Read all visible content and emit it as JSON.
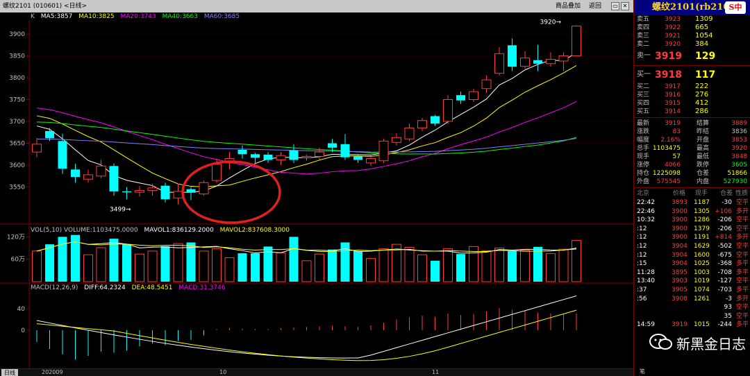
{
  "window": {
    "title": "螺纹2101 (010601) <日线>",
    "menu_add": "商品叠加",
    "menu_back": "返回",
    "btns": [
      "□",
      "▭",
      "✕"
    ]
  },
  "kline_legend": {
    "k": "K",
    "ma5": "MA5:3857",
    "ma10": "MA10:3825",
    "ma20": "MA20:3743",
    "ma40": "MA40:3663",
    "ma60": "MA60:3685"
  },
  "vol_legend": {
    "vol": "VOL(5,10) VOLUME:1103475.0000",
    "mavol1": "MAVOL1:836129.2000",
    "mavol2": "MAVOL2:837608.3000"
  },
  "macd_legend": {
    "macd": "MACD(12,26,9)",
    "diff": "DIFF:64.2324",
    "dea": "DEA:48.5451",
    "macdval": "MACD:31.3746"
  },
  "price_axis": [
    "3900",
    "3850",
    "3800",
    "3750",
    "3700",
    "3650",
    "3600",
    "3550"
  ],
  "vol_axis": [
    "120万",
    "60万"
  ],
  "macd_axis": [
    "40",
    "0"
  ],
  "annotations": {
    "high": "3920→",
    "low": "3499→"
  },
  "x_labels": {
    "tab": "日线",
    "start": "202009",
    "m10": "10",
    "m11": "11"
  },
  "colors": {
    "up": "#ff3b3b",
    "down": "#00ffff",
    "ma5": "#ffffff",
    "ma10": "#ffff00",
    "ma20": "#ff00ff",
    "ma40": "#00ff00",
    "ma60": "#8080ff",
    "circle": "#e02020"
  },
  "chart_data": {
    "type": "candlestick",
    "title": "螺纹2101 (010601) 日线",
    "ylim": [
      3470,
      3930
    ],
    "candles": [
      {
        "o": 3630,
        "c": 3648,
        "h": 3662,
        "l": 3618,
        "v": 820000,
        "m": -22
      },
      {
        "o": 3678,
        "c": 3662,
        "h": 3685,
        "l": 3655,
        "v": 1000000,
        "m": -35
      },
      {
        "o": 3655,
        "c": 3592,
        "h": 3672,
        "l": 3580,
        "v": 1200000,
        "m": -45
      },
      {
        "o": 3590,
        "c": 3573,
        "h": 3603,
        "l": 3560,
        "v": 1250000,
        "m": -55
      },
      {
        "o": 3568,
        "c": 3578,
        "h": 3590,
        "l": 3560,
        "v": 720000,
        "m": -48
      },
      {
        "o": 3575,
        "c": 3598,
        "h": 3612,
        "l": 3570,
        "v": 910000,
        "m": -40
      },
      {
        "o": 3598,
        "c": 3540,
        "h": 3604,
        "l": 3530,
        "v": 1150000,
        "m": -42
      },
      {
        "o": 3540,
        "c": 3538,
        "h": 3550,
        "l": 3522,
        "v": 1000000,
        "m": -38
      },
      {
        "o": 3538,
        "c": 3542,
        "h": 3552,
        "l": 3528,
        "v": 740000,
        "m": -30
      },
      {
        "o": 3542,
        "c": 3548,
        "h": 3558,
        "l": 3530,
        "v": 820000,
        "m": -25
      },
      {
        "o": 3553,
        "c": 3522,
        "h": 3560,
        "l": 3515,
        "v": 950000,
        "m": -28
      },
      {
        "o": 3525,
        "c": 3540,
        "h": 3558,
        "l": 3510,
        "v": 1020000,
        "m": -20
      },
      {
        "o": 3545,
        "c": 3537,
        "h": 3550,
        "l": 3520,
        "v": 1050000,
        "m": -18
      },
      {
        "o": 3534,
        "c": 3560,
        "h": 3565,
        "l": 3530,
        "v": 820000,
        "m": -10
      },
      {
        "o": 3565,
        "c": 3602,
        "h": 3615,
        "l": 3560,
        "v": 880000,
        "m": 2
      },
      {
        "o": 3605,
        "c": 3615,
        "h": 3630,
        "l": 3590,
        "v": 640000,
        "m": 4
      },
      {
        "o": 3635,
        "c": 3625,
        "h": 3645,
        "l": 3615,
        "v": 760000,
        "m": 3
      },
      {
        "o": 3625,
        "c": 3617,
        "h": 3628,
        "l": 3605,
        "v": 760000,
        "m": 2
      },
      {
        "o": 3624,
        "c": 3612,
        "h": 3630,
        "l": 3605,
        "v": 940000,
        "m": 2
      },
      {
        "o": 3612,
        "c": 3622,
        "h": 3630,
        "l": 3600,
        "v": 770000,
        "m": 4
      },
      {
        "o": 3634,
        "c": 3612,
        "h": 3648,
        "l": 3605,
        "v": 1200000,
        "m": 5
      },
      {
        "o": 3617,
        "c": 3620,
        "h": 3624,
        "l": 3610,
        "v": 560000,
        "m": 6
      },
      {
        "o": 3620,
        "c": 3630,
        "h": 3640,
        "l": 3612,
        "v": 740000,
        "m": 7
      },
      {
        "o": 3650,
        "c": 3640,
        "h": 3660,
        "l": 3630,
        "v": 860000,
        "m": 8
      },
      {
        "o": 3648,
        "c": 3618,
        "h": 3671,
        "l": 3612,
        "v": 1050000,
        "m": 7
      },
      {
        "o": 3620,
        "c": 3612,
        "h": 3625,
        "l": 3605,
        "v": 820000,
        "m": 6
      },
      {
        "o": 3605,
        "c": 3615,
        "h": 3622,
        "l": 3598,
        "v": 620000,
        "m": 9
      },
      {
        "o": 3610,
        "c": 3655,
        "h": 3660,
        "l": 3605,
        "v": 880000,
        "m": 14
      },
      {
        "o": 3652,
        "c": 3663,
        "h": 3673,
        "l": 3645,
        "v": 1000000,
        "m": 20
      },
      {
        "o": 3660,
        "c": 3685,
        "h": 3695,
        "l": 3655,
        "v": 920000,
        "m": 24
      },
      {
        "o": 3685,
        "c": 3702,
        "h": 3708,
        "l": 3678,
        "v": 720000,
        "m": 27
      },
      {
        "o": 3712,
        "c": 3695,
        "h": 3715,
        "l": 3690,
        "v": 560000,
        "m": 25
      },
      {
        "o": 3700,
        "c": 3750,
        "h": 3760,
        "l": 3694,
        "v": 880000,
        "m": 31
      },
      {
        "o": 3760,
        "c": 3748,
        "h": 3768,
        "l": 3740,
        "v": 740000,
        "m": 28
      },
      {
        "o": 3750,
        "c": 3768,
        "h": 3775,
        "l": 3745,
        "v": 940000,
        "m": 30
      },
      {
        "o": 3775,
        "c": 3795,
        "h": 3805,
        "l": 3765,
        "v": 830000,
        "m": 35
      },
      {
        "o": 3810,
        "c": 3855,
        "h": 3870,
        "l": 3805,
        "v": 900000,
        "m": 41
      },
      {
        "o": 3874,
        "c": 3825,
        "h": 3890,
        "l": 3815,
        "v": 820000,
        "m": 38
      },
      {
        "o": 3826,
        "c": 3845,
        "h": 3860,
        "l": 3820,
        "v": 840000,
        "m": 36
      },
      {
        "o": 3840,
        "c": 3832,
        "h": 3875,
        "l": 3815,
        "v": 930000,
        "m": 33
      },
      {
        "o": 3832,
        "c": 3842,
        "h": 3858,
        "l": 3825,
        "v": 750000,
        "m": 31
      },
      {
        "o": 3838,
        "c": 3850,
        "h": 3858,
        "l": 3815,
        "v": 870000,
        "m": 30
      },
      {
        "o": 3850,
        "c": 3918,
        "h": 3920,
        "l": 3848,
        "v": 1103475,
        "m": 31
      }
    ],
    "volume_ylim": [
      0,
      1300000
    ],
    "macd_ylim": [
      -70,
      75
    ]
  },
  "quote": {
    "title": "螺纹2101(rb2101)",
    "sohu": "S中",
    "asks": [
      {
        "label": "卖五",
        "price": "3923",
        "vol": "1309"
      },
      {
        "label": "卖四",
        "price": "3922",
        "vol": "665"
      },
      {
        "label": "卖三",
        "price": "3921",
        "vol": "1054"
      },
      {
        "label": "卖二",
        "price": "3920",
        "vol": "384"
      }
    ],
    "ask1": {
      "label": "卖一",
      "price": "3919",
      "vol": "129"
    },
    "bid1": {
      "label": "买一",
      "price": "3918",
      "vol": "117"
    },
    "bids": [
      {
        "label": "买二",
        "price": "3917",
        "vol": "222"
      },
      {
        "label": "买三",
        "price": "3916",
        "vol": "276"
      },
      {
        "label": "买四",
        "price": "3915",
        "vol": "412"
      },
      {
        "label": "买五",
        "price": "3914",
        "vol": "286"
      }
    ],
    "stats": [
      {
        "l1": "最新",
        "v1": "3919",
        "l2": "结算",
        "v2": "3889",
        "c1": "#ff3b3b",
        "c2": "#ff3b3b"
      },
      {
        "l1": "涨跌",
        "v1": "83",
        "l2": "昨结",
        "v2": "3836",
        "c1": "#ff3b3b",
        "c2": "#c0c0c0"
      },
      {
        "l1": "幅度",
        "v1": "2.16%",
        "l2": "开盘",
        "v2": "3853",
        "c1": "#ff3b3b",
        "c2": "#ff3b3b"
      },
      {
        "l1": "总手",
        "v1": "1103475",
        "l2": "最高",
        "v2": "3920",
        "c1": "#ffff00",
        "c2": "#ff3b3b"
      },
      {
        "l1": "现手",
        "v1": "57",
        "l2": "最低",
        "v2": "3848",
        "c1": "#ffff00",
        "c2": "#ff3b3b"
      },
      {
        "l1": "涨停",
        "v1": "4066",
        "l2": "跌停",
        "v2": "3605",
        "c1": "#ff3b3b",
        "c2": "#00ff00"
      },
      {
        "l1": "持仓",
        "v1": "1225098",
        "l2": "仓差",
        "v2": "51866",
        "c1": "#ffff00",
        "c2": "#ffff00"
      },
      {
        "l1": "外盘",
        "v1": "575545",
        "l2": "内盘",
        "v2": "527930",
        "c1": "#ff3b3b",
        "c2": "#00ff00"
      }
    ],
    "tick_head": {
      "loc": "北京",
      "price": "价格",
      "vol": "现手",
      "diff": "仓差",
      "nature": "性质"
    },
    "ticks": [
      {
        "t": "22:42",
        "p": "3893",
        "v": "1187",
        "d": "-30",
        "n": "空平"
      },
      {
        "t": "22:46",
        "p": "3900",
        "v": "1305",
        "d": "+106",
        "n": "多开"
      },
      {
        "t": "10:32",
        "p": "3900",
        "v": "1286",
        "d": "-206",
        "n": "空平"
      },
      {
        "t": ":12",
        "p": "3900",
        "v": "1379",
        "d": "-206",
        "n": "空平"
      },
      {
        "t": ":12",
        "p": "3900",
        "v": "1191",
        "d": "+814",
        "n": "多开"
      },
      {
        "t": ":12",
        "p": "3904",
        "v": "1629",
        "d": "-502",
        "n": "空平"
      },
      {
        "t": ":12",
        "p": "3904",
        "v": "1600",
        "d": "-675",
        "n": "空平"
      },
      {
        "t": ":15",
        "p": "3904",
        "v": "1025",
        "d": "-368",
        "n": "多平"
      },
      {
        "t": "11:28",
        "p": "3895",
        "v": "1003",
        "d": "-708",
        "n": "多平"
      },
      {
        "t": "13:40",
        "p": "3903",
        "v": "1019",
        "d": "-127",
        "n": "空平"
      },
      {
        "t": ":37",
        "p": "3905",
        "v": "1074",
        "d": "-703",
        "n": "多平"
      },
      {
        "t": ":56",
        "p": "3908",
        "v": "1261",
        "d": "-3",
        "n": "多开"
      },
      {
        "t": "",
        "p": "",
        "v": "",
        "d": "93",
        "n": "空平"
      },
      {
        "t": "",
        "p": "",
        "v": "",
        "d": "35",
        "n": "空平"
      },
      {
        "t": "14:59",
        "p": "3919",
        "v": "1015",
        "d": "-244",
        "n": "多平"
      }
    ],
    "foot": "笔"
  },
  "watermark": "新黑金日志"
}
